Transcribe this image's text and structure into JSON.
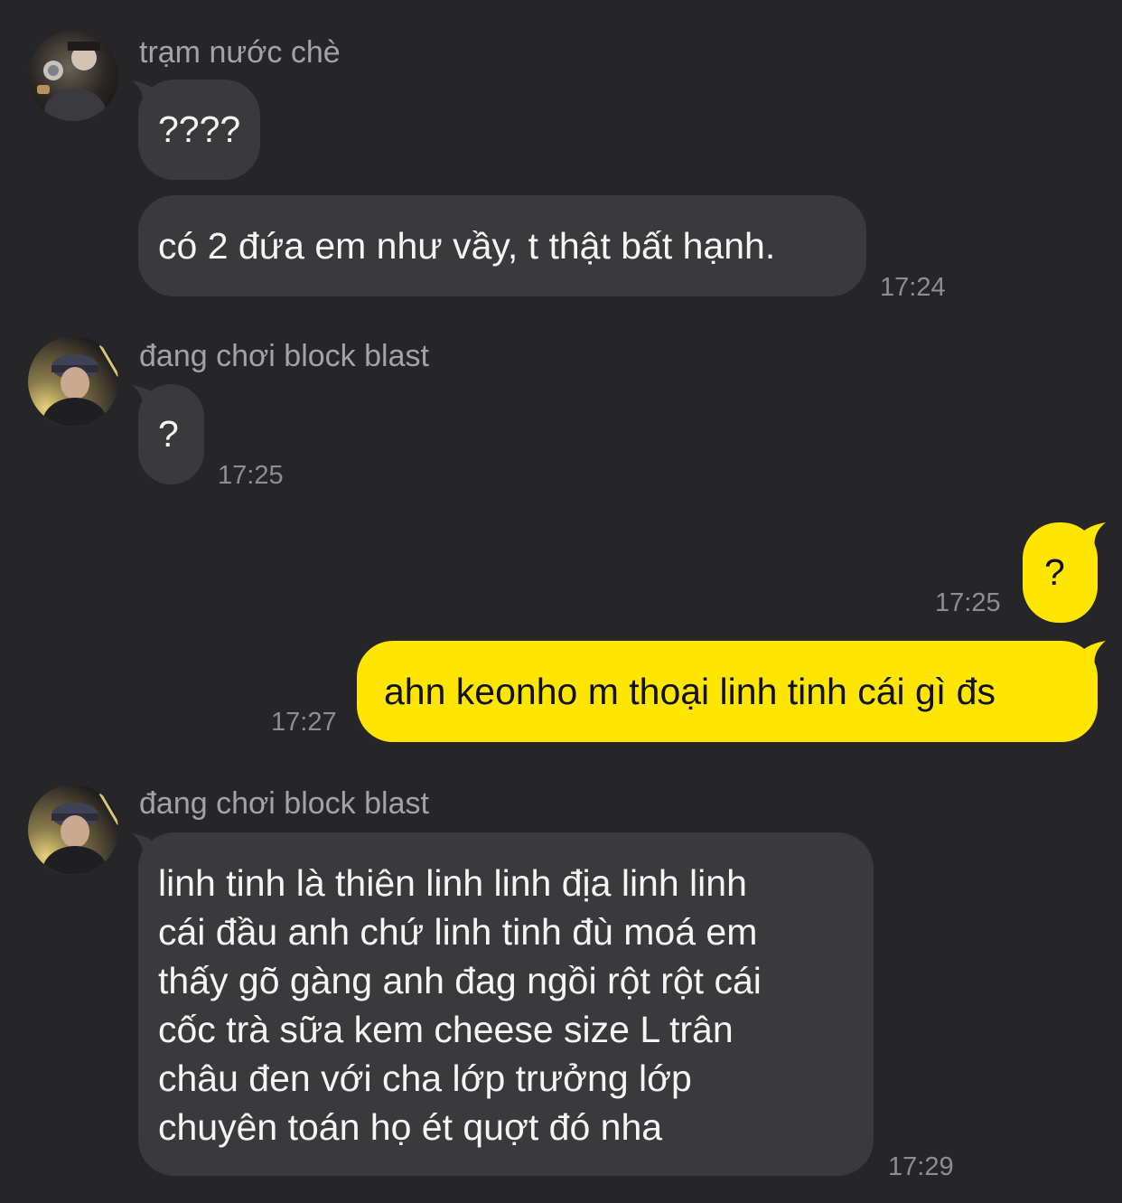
{
  "colors": {
    "background": "#262628",
    "incoming_bubble": "#3a3a3c",
    "outgoing_bubble": "#ffe600",
    "sender_name": "#a3a3a5",
    "timestamp": "#8e8e92"
  },
  "messages": {
    "group1": {
      "sender": "trạm nước chè",
      "avatar_icon": "user-avatar-icon",
      "bubble1": "????",
      "bubble2": "có 2 đứa em như vầy, t thật bất hạnh.",
      "time": "17:24"
    },
    "group2": {
      "sender": "đang chơi block blast",
      "avatar_icon": "user-avatar-icon",
      "bubble1": "?",
      "time": "17:25"
    },
    "outgoing": {
      "bubble1": "?",
      "time1": "17:25",
      "bubble2": "ahn keonho m thoại linh tinh cái gì đs",
      "time2": "17:27"
    },
    "group3": {
      "sender": "đang chơi block blast",
      "avatar_icon": "user-avatar-icon",
      "lines": [
        "linh tinh là thiên linh linh địa linh linh",
        "cái đầu anh chứ linh tinh đù moá em",
        "thấy gõ gàng anh đag ngồi rột rột cái",
        "cốc trà sữa kem cheese size L trân",
        "châu đen với cha lớp trưởng lớp",
        "chuyên toán họ ét quợt đó nha"
      ],
      "time": "17:29"
    }
  }
}
